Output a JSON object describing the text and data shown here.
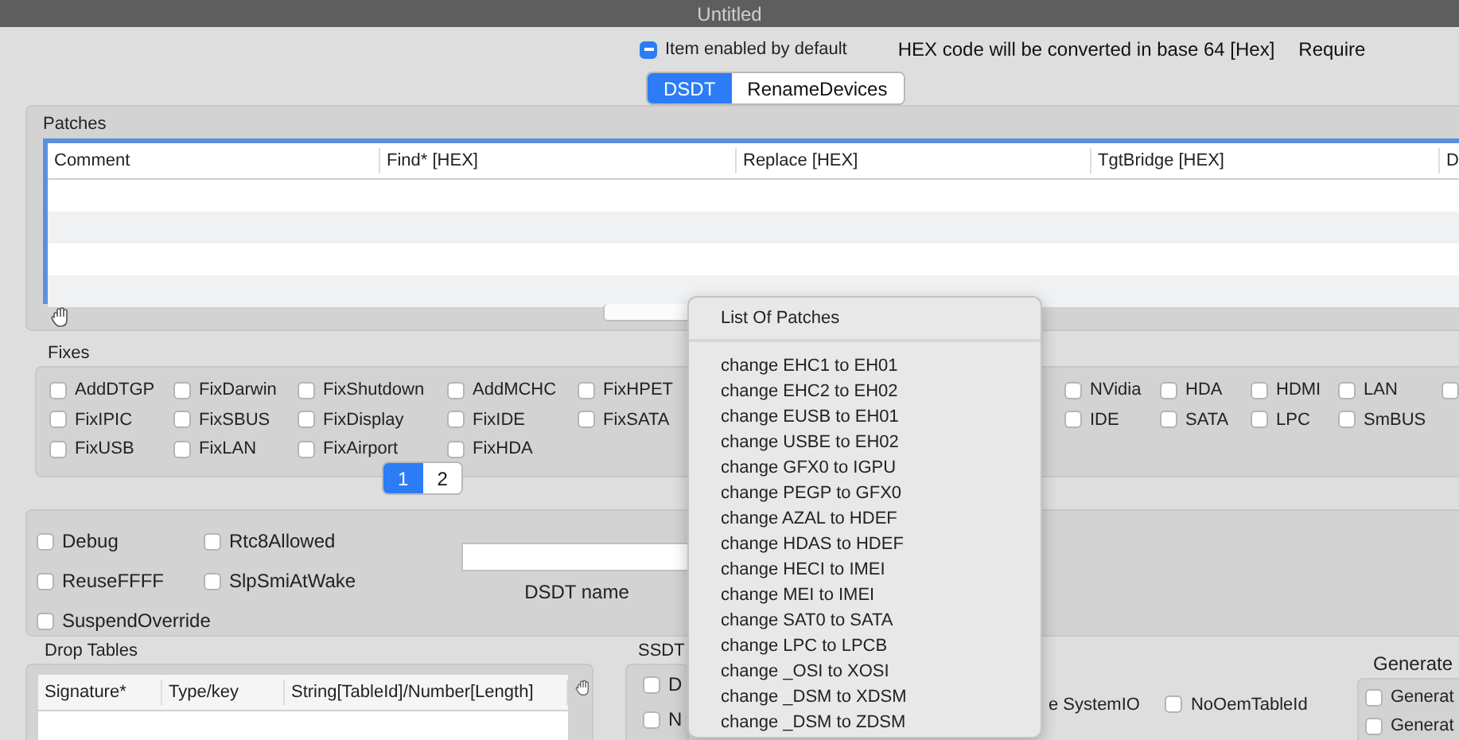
{
  "window": {
    "title": "Untitled"
  },
  "header": {
    "enabled_default": {
      "label": "Item enabled by default",
      "mixed": true
    },
    "hex_note": "HEX code will be converted in base 64 [Hex]",
    "require_note": "Require"
  },
  "tabs": [
    {
      "label": "DSDT",
      "selected": true
    },
    {
      "label": "RenameDevices",
      "selected": false
    }
  ],
  "patches": {
    "title": "Patches",
    "columns": [
      "Comment",
      "Find* [HEX]",
      "Replace [HEX]",
      "TgtBridge [HEX]",
      "D"
    ]
  },
  "fixes": {
    "title": "Fixes",
    "rows": [
      [
        {
          "label": "AddDTGP",
          "checked": false
        },
        {
          "label": "FixDarwin",
          "checked": false
        },
        {
          "label": "FixShutdown",
          "checked": false
        },
        {
          "label": "AddMCHC",
          "checked": false
        },
        {
          "label": "FixHPET",
          "checked": false
        }
      ],
      [
        {
          "label": "FixIPIC",
          "checked": false
        },
        {
          "label": "FixSBUS",
          "checked": false
        },
        {
          "label": "FixDisplay",
          "checked": false
        },
        {
          "label": "FixIDE",
          "checked": false
        },
        {
          "label": "FixSATA",
          "checked": false
        }
      ],
      [
        {
          "label": "FixUSB",
          "checked": false
        },
        {
          "label": "FixLAN",
          "checked": false
        },
        {
          "label": "FixAirport",
          "checked": false
        },
        {
          "label": "FixHDA",
          "checked": false
        }
      ]
    ],
    "right_rows": [
      [
        {
          "label": "NVidia",
          "checked": false
        },
        {
          "label": "HDA",
          "checked": false
        },
        {
          "label": "HDMI",
          "checked": false
        },
        {
          "label": "LAN",
          "checked": false
        },
        {
          "checked": false
        }
      ],
      [
        {
          "label": "IDE",
          "checked": false
        },
        {
          "label": "SATA",
          "checked": false
        },
        {
          "label": "LPC",
          "checked": false
        },
        {
          "label": "SmBUS",
          "checked": false
        }
      ]
    ]
  },
  "pages": [
    {
      "label": "1",
      "selected": true
    },
    {
      "label": "2",
      "selected": false
    }
  ],
  "options": [
    {
      "label": "Debug",
      "checked": false
    },
    {
      "label": "Rtc8Allowed",
      "checked": false
    },
    {
      "label": "ReuseFFFF",
      "checked": false
    },
    {
      "label": "SlpSmiAtWake",
      "checked": false
    },
    {
      "label": "SuspendOverride",
      "checked": false
    }
  ],
  "dsdt_name": {
    "label": "DSDT name"
  },
  "drop_tables": {
    "title": "Drop Tables",
    "columns": [
      "Signature*",
      "Type/key",
      "String[TableId]/Number[Length]"
    ]
  },
  "ssdt": {
    "title": "SSDT",
    "options": [
      {
        "label": "D",
        "checked": false
      },
      {
        "label": "N",
        "checked": false
      }
    ],
    "system_io_fragment": "e SystemIO",
    "no_oem_table_id": {
      "label": "NoOemTableId",
      "checked": false
    }
  },
  "generate": {
    "title": "Generate",
    "options": [
      {
        "label": "Generat",
        "checked": false
      },
      {
        "label": "Generat",
        "checked": false
      }
    ]
  },
  "popup": {
    "title": "List Of Patches",
    "items": [
      "change EHC1 to EH01",
      "change EHC2 to EH02",
      "change EUSB to EH01",
      "change USBE to EH02",
      "change GFX0 to IGPU",
      "change PEGP to GFX0",
      "change AZAL to HDEF",
      "change HDAS to HDEF",
      "change HECI to IMEI",
      "change MEI to IMEI",
      "change SAT0 to SATA",
      "change LPC to LPCB",
      "change _OSI to XOSI",
      "change _DSM to XDSM",
      "change _DSM to ZDSM"
    ]
  }
}
